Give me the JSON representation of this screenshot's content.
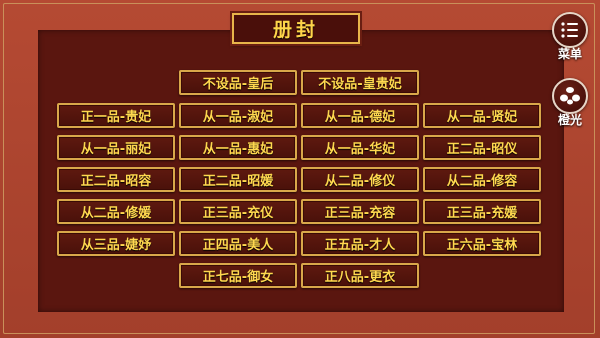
{
  "title": "册封",
  "ranks": [
    "不设品-皇后",
    "不设品-皇贵妃",
    "正一品-贵妃",
    "从一品-淑妃",
    "从一品-德妃",
    "从一品-贤妃",
    "从一品-丽妃",
    "从一品-惠妃",
    "从一品-华妃",
    "正二品-昭仪",
    "正二品-昭容",
    "正二品-昭媛",
    "从二品-修仪",
    "从二品-修容",
    "从二品-修媛",
    "正三品-充仪",
    "正三品-充容",
    "正三品-充媛",
    "从三品-婕妤",
    "正四品-美人",
    "正五品-才人",
    "正六品-宝林",
    "正七品-御女",
    "正八品-更衣"
  ],
  "side": {
    "menu_label": "菜单",
    "orange_label": "橙光",
    "menu_icon": "list-icon",
    "orange_icon": "orange-light-logo"
  }
}
